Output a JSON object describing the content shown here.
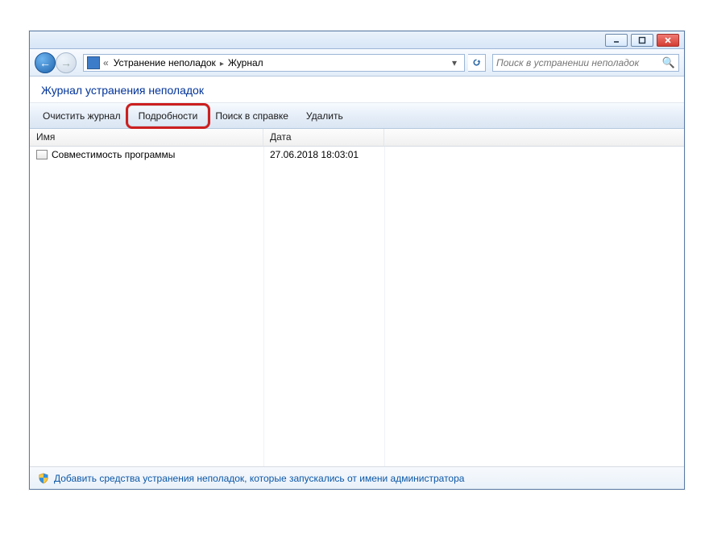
{
  "breadcrumb": {
    "part1": "Устранение неполадок",
    "part2": "Журнал"
  },
  "search": {
    "placeholder": "Поиск в устранении неполадок"
  },
  "heading": "Журнал устранения неполадок",
  "toolbar": {
    "clear": "Очистить журнал",
    "details": "Подробности",
    "help": "Поиск в справке",
    "delete": "Удалить"
  },
  "columns": {
    "name": "Имя",
    "date": "Дата"
  },
  "rows": [
    {
      "name": "Совместимость программы",
      "date": "27.06.2018 18:03:01"
    }
  ],
  "footer": {
    "link": "Добавить средства устранения неполадок, которые запускались от имени администратора"
  },
  "highlighted_button": "details"
}
